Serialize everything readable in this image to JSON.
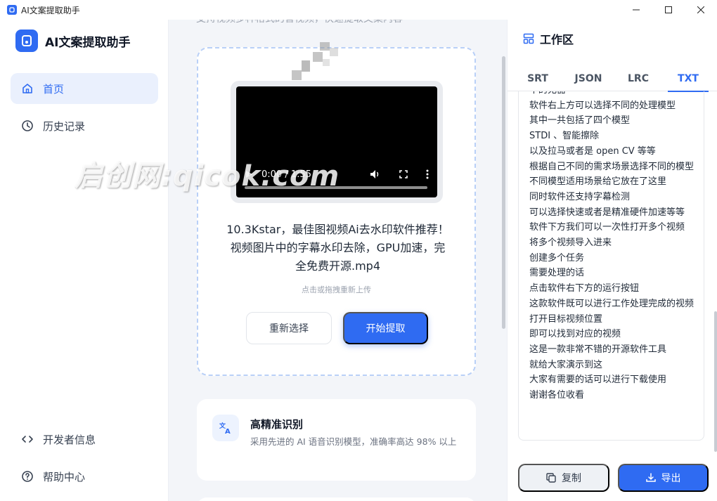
{
  "window": {
    "title": "AI文案提取助手"
  },
  "sidebar": {
    "brand": "AI文案提取助手",
    "nav": [
      {
        "label": "首页",
        "icon": "home-icon",
        "active": true
      },
      {
        "label": "历史记录",
        "icon": "clock-icon",
        "active": false
      }
    ],
    "bottom": [
      {
        "label": "开发者信息",
        "icon": "code-icon"
      },
      {
        "label": "帮助中心",
        "icon": "help-icon"
      }
    ]
  },
  "main": {
    "top_text": "支持视频多种格式的音视频，快速提取文案内容",
    "video": {
      "time": "0:00 / 1:55"
    },
    "filename": "10.3Kstar，最佳图视频Ai去水印软件推荐！视频图片中的字幕水印去除，GPU加速，完全免费开源.mp4",
    "hint": "点击或拖拽重新上传",
    "reselect_label": "重新选择",
    "start_label": "开始提取",
    "feature": {
      "title": "高精准识别",
      "desc": "采用先进的 AI 语音识别模型，准确率高达 98% 以上"
    }
  },
  "workspace": {
    "title": "工作区",
    "tabs": [
      "SRT",
      "JSON",
      "LRC",
      "TXT"
    ],
    "active_tab": "TXT",
    "lines": [
      "中的无器",
      "软件右上方可以选择不同的处理模型",
      "其中一共包括了四个模型",
      "STDI 、智能擦除",
      "以及拉马或者是 open CV 等等",
      "根据自己不同的需求场景选择不同的模型",
      "不同模型适用场景给它放在了这里",
      "同时软件还支持字幕检测",
      "可以选择快速或者是精准硬件加速等等",
      "软件下方我们可以一次性打开多个视频",
      "将多个视频导入进来",
      "创建多个任务",
      "需要处理的话",
      "点击软件右下方的运行按钮",
      "这款软件既可以进行工作处理完成的视频",
      "打开目标视频位置",
      "即可以找到对应的视频",
      "这是一款非常不错的开源软件工具",
      "就给大家演示到这",
      "大家有需要的话可以进行下载使用",
      "谢谢各位收看"
    ],
    "copy_label": "复制",
    "export_label": "导出"
  },
  "overlay": {
    "watermark": "启创网:qicok.com"
  },
  "colors": {
    "accent": "#2f6bf2",
    "active_nav_bg": "#eaf0fd"
  }
}
